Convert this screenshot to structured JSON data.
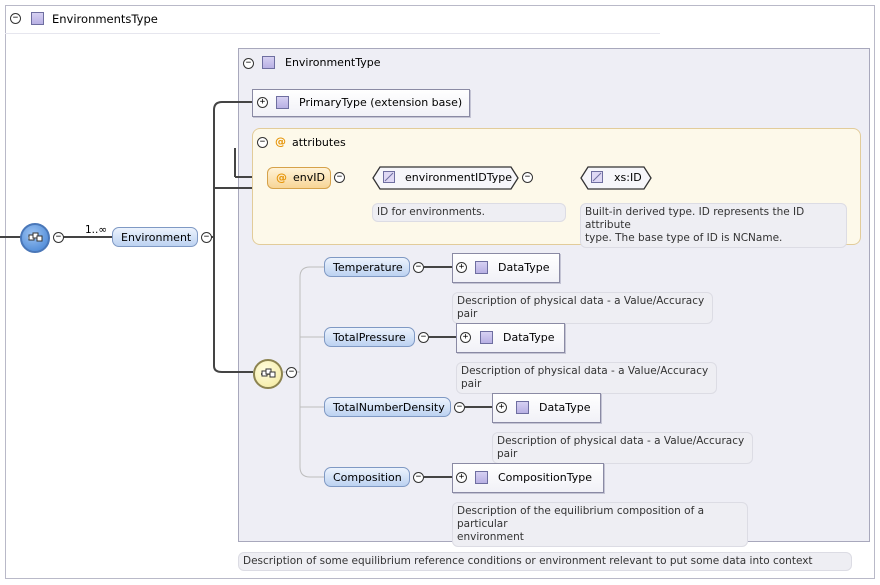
{
  "root": {
    "title": "EnvironmentsType",
    "collapse_symbol": "−"
  },
  "cardinality": "1..∞",
  "environment_element": {
    "label": "Environment"
  },
  "environment_type": {
    "title": "EnvironmentType"
  },
  "primary_type": {
    "label": "PrimaryType (extension base)",
    "expand_symbol": "+"
  },
  "attributes": {
    "title": "attributes",
    "at_symbol": "@",
    "env_id": {
      "label": "envID"
    },
    "environment_id_type": {
      "label": "environmentIDType",
      "note": "ID for environments."
    },
    "xs_id": {
      "label": "xs:ID",
      "note_line1": "Built-in derived type. ID represents the ID attribute",
      "note_line2": "type. The base type of ID is NCName."
    }
  },
  "children": [
    {
      "label": "Temperature",
      "type": "DataType",
      "note_line1": "Description of physical data - a Value/Accuracy pair",
      "note_line2": ""
    },
    {
      "label": "TotalPressure",
      "type": "DataType",
      "note_line1": "Description of physical data - a Value/Accuracy pair",
      "note_line2": ""
    },
    {
      "label": "TotalNumberDensity",
      "type": "DataType",
      "note_line1": "Description of physical data - a Value/Accuracy pair",
      "note_line2": ""
    },
    {
      "label": "Composition",
      "type": "CompositionType",
      "note_line1": "Description of the equilibrium composition of a particular",
      "note_line2": "environment"
    }
  ],
  "environment_note": "Description of some equilibrium reference conditions or environment relevant to put some data into context",
  "symbols": {
    "minus": "−",
    "plus": "+"
  },
  "colors": {
    "element_fill": "#bcd2f1",
    "attribute_fill": "#f7d596",
    "type_icon": "#b8b0e4",
    "panel_bg": "#eeeef5",
    "attr_panel_bg": "#fdf9ea"
  }
}
